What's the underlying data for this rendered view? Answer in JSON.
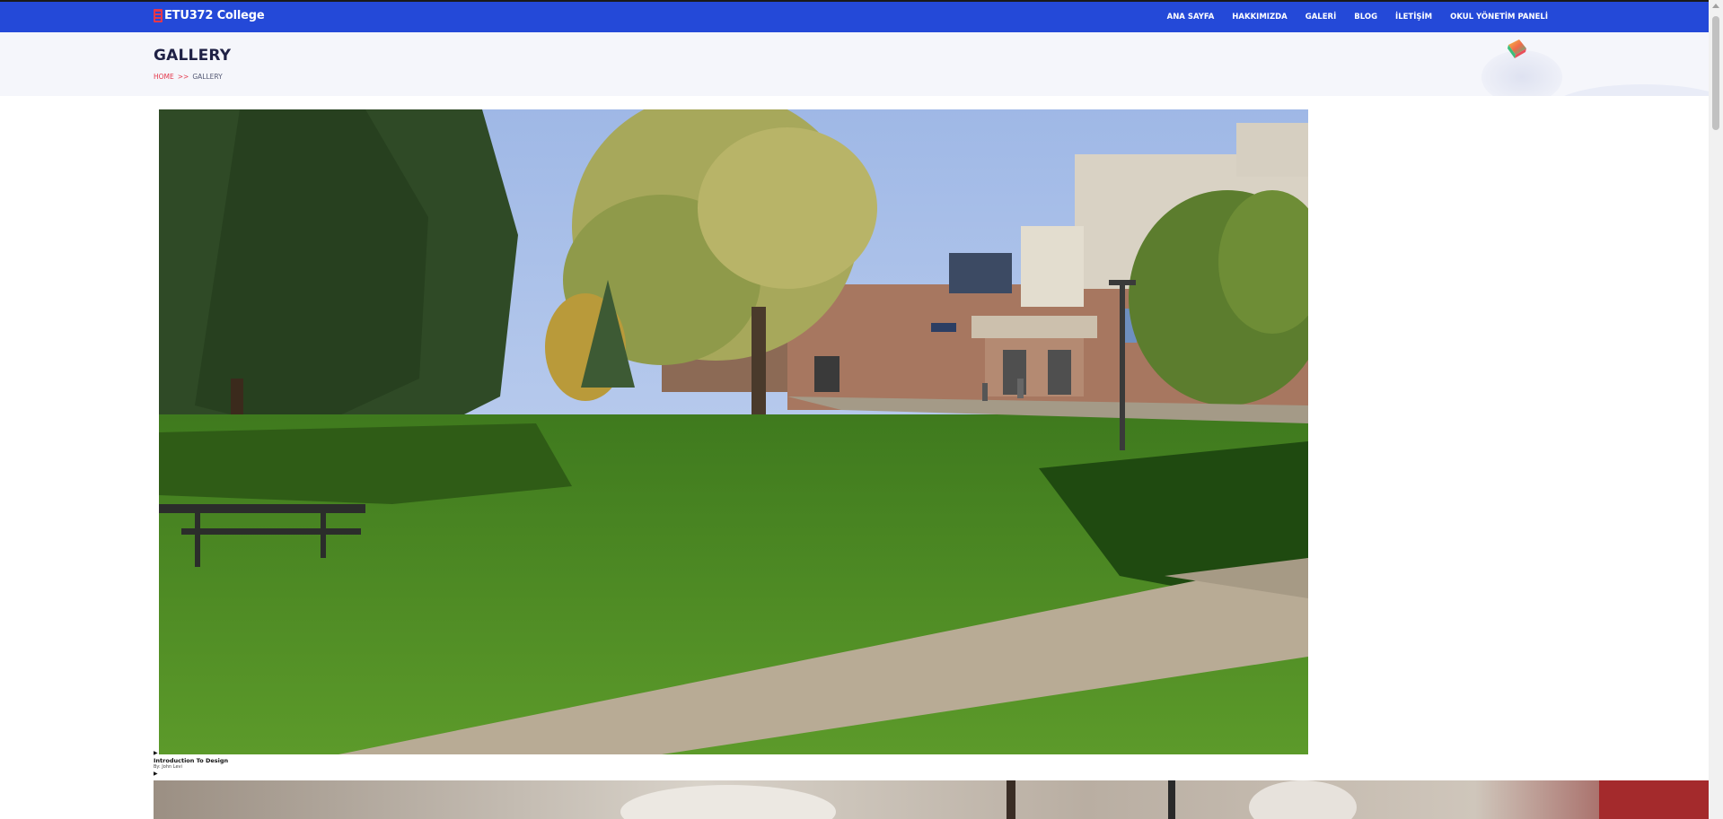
{
  "brand": {
    "name": "ETU372 College",
    "accent": "#2449d8",
    "logo_icon": "college-logo-icon"
  },
  "nav": {
    "items": [
      {
        "label": "ANA SAYFA"
      },
      {
        "label": "HAKKIMIZDA"
      },
      {
        "label": "GALERİ"
      },
      {
        "label": "BLOG"
      },
      {
        "label": "İLETİŞİM"
      },
      {
        "label": "OKUL YÖNETİM PANELİ"
      }
    ]
  },
  "page_header": {
    "title": "GALLERY",
    "breadcrumb": {
      "home": "HOME",
      "separator": ">>",
      "current": "GALLERY"
    }
  },
  "gallery": {
    "items": [
      {
        "marker": "▶",
        "title": "Introduction To Design",
        "author": "By: John Levi",
        "image": "campus-lawn-photo"
      },
      {
        "marker": "▶",
        "image": "indoor-photo"
      }
    ]
  },
  "colors": {
    "header_bg": "#f5f6fb",
    "breadcrumb_home": "#e4374b",
    "title": "#1f2145"
  }
}
